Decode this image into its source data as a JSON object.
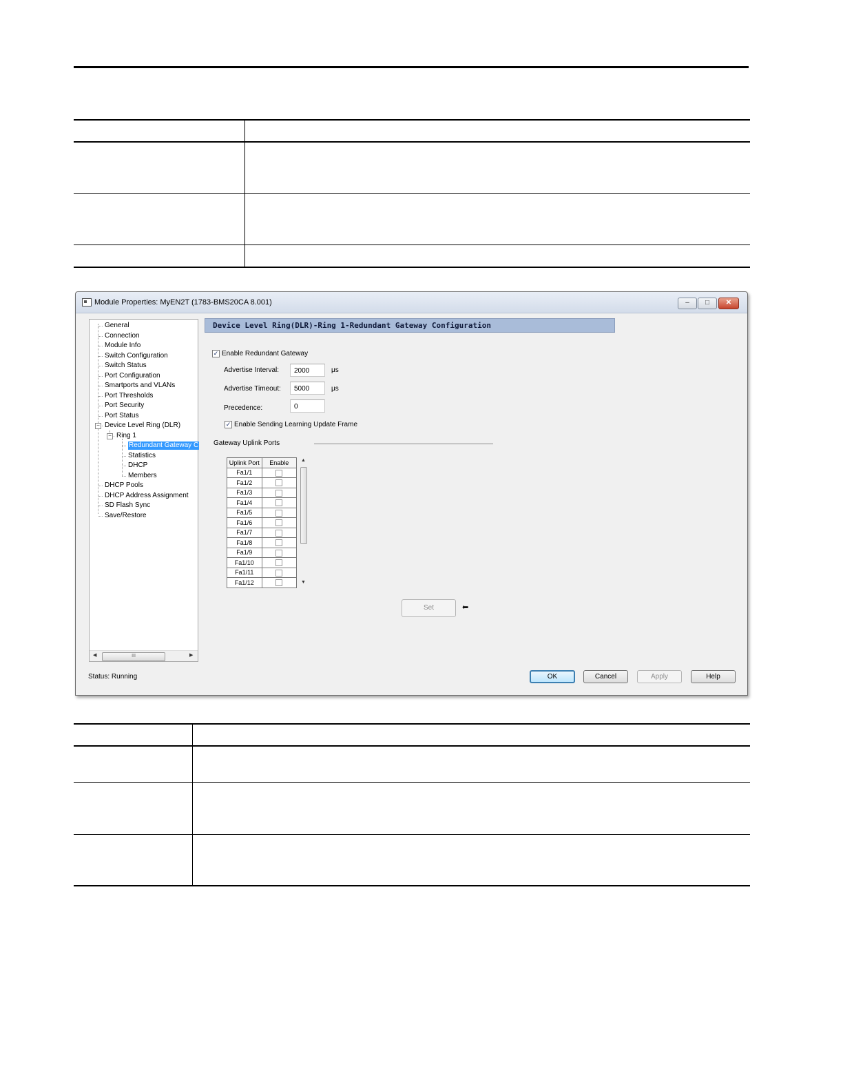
{
  "dialog": {
    "title": "Module Properties: MyEN2T (1783-BMS20CA 8.001)",
    "controls": {
      "minimize": "–",
      "maximize": "□",
      "close": "✕"
    },
    "tree": {
      "items": [
        "General",
        "Connection",
        "Module Info",
        "Switch Configuration",
        "Switch Status",
        "Port Configuration",
        "Smartports and VLANs",
        "Port Thresholds",
        "Port Security",
        "Port Status",
        "Device Level Ring (DLR)"
      ],
      "ring": "Ring 1",
      "ring_children": [
        "Redundant Gateway C",
        "Statistics",
        "DHCP",
        "Members"
      ],
      "items_after": [
        "DHCP Pools",
        "DHCP Address Assignment",
        "SD Flash Sync",
        "Save/Restore"
      ],
      "scroll_thumb": "III"
    },
    "header": "Device Level Ring(DLR)-Ring 1-Redundant Gateway Configuration",
    "enable_redundant_gateway": {
      "label": "Enable Redundant Gateway",
      "checked": true
    },
    "advertise_interval": {
      "label": "Advertise Interval:",
      "value": "2000",
      "unit": "μs"
    },
    "advertise_timeout": {
      "label": "Advertise Timeout:",
      "value": "5000",
      "unit": "μs"
    },
    "precedence": {
      "label": "Precedence:",
      "value": "0"
    },
    "enable_learning_update": {
      "label": "Enable Sending Learning Update Frame",
      "checked": true
    },
    "uplink_ports": {
      "group_label": "Gateway Uplink Ports",
      "columns": [
        "Uplink Port",
        "Enable"
      ],
      "rows": [
        "Fa1/1",
        "Fa1/2",
        "Fa1/3",
        "Fa1/4",
        "Fa1/5",
        "Fa1/6",
        "Fa1/7",
        "Fa1/8",
        "Fa1/9",
        "Fa1/10",
        "Fa1/11",
        "Fa1/12"
      ]
    },
    "set_button": "Set",
    "status_text": "Status:  Running",
    "buttons": {
      "ok": "OK",
      "cancel": "Cancel",
      "apply": "Apply",
      "help": "Help"
    }
  }
}
